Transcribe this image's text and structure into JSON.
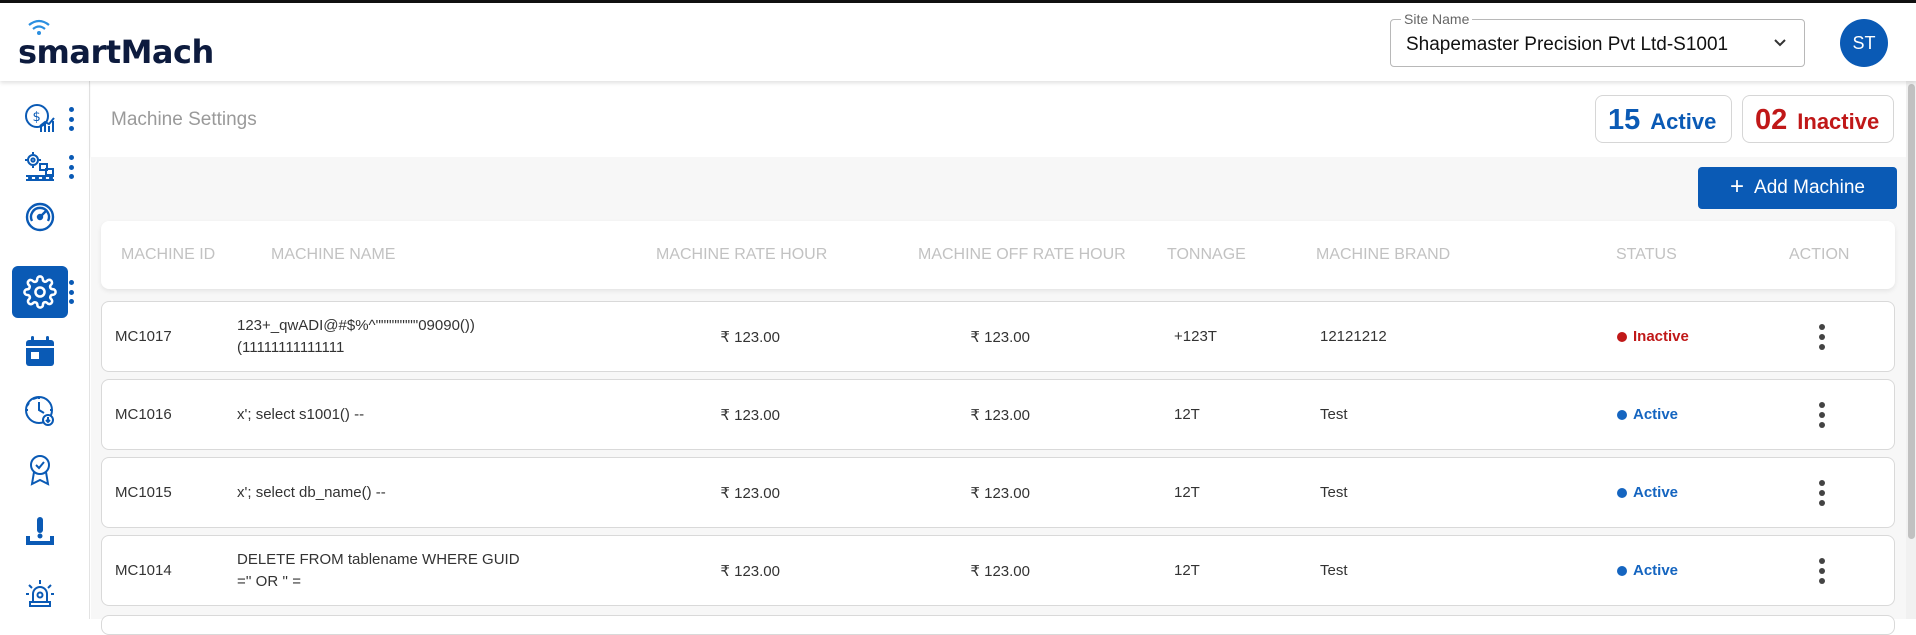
{
  "app": {
    "logo_text": "smartMach",
    "site_label": "Site Name",
    "site_value": "Shapemaster Precision Pvt Ltd-S1001",
    "avatar_initials": "ST"
  },
  "sidebar": {
    "items": [
      {
        "icon": "cost-analytics-icon",
        "has_menu": true
      },
      {
        "icon": "machine-conveyor-icon",
        "has_menu": true
      },
      {
        "icon": "gauge-icon",
        "has_menu": false
      },
      {
        "icon": "settings-gear-icon",
        "has_menu": true,
        "active": true
      },
      {
        "icon": "calendar-icon",
        "has_menu": false
      },
      {
        "icon": "clock-download-icon",
        "has_menu": false
      },
      {
        "icon": "award-badge-icon",
        "has_menu": false
      },
      {
        "icon": "tool-probe-icon",
        "has_menu": false
      },
      {
        "icon": "alarm-light-icon",
        "has_menu": false
      }
    ]
  },
  "page": {
    "title": "Machine Settings",
    "active_count": "15",
    "active_label": "Active",
    "inactive_count": "02",
    "inactive_label": "Inactive",
    "add_button": "Add Machine"
  },
  "table": {
    "headers": [
      "MACHINE ID",
      "MACHINE NAME",
      "MACHINE RATE HOUR",
      "MACHINE OFF RATE HOUR",
      "TONNAGE",
      "MACHINE BRAND",
      "STATUS",
      "ACTION"
    ],
    "rows": [
      {
        "id": "MC1017",
        "name": "123+_qwADI@#$%^\"\"\"\"\"\"\"\"09090())(11111111111111",
        "rate": "₹ 123.00",
        "off_rate": "₹ 123.00",
        "tonnage": "+123T",
        "brand": "12121212",
        "status": "Inactive"
      },
      {
        "id": "MC1016",
        "name": "x'; select s1001() --",
        "rate": "₹ 123.00",
        "off_rate": "₹ 123.00",
        "tonnage": "12T",
        "brand": "Test",
        "status": "Active"
      },
      {
        "id": "MC1015",
        "name": "x'; select db_name() --",
        "rate": "₹ 123.00",
        "off_rate": "₹ 123.00",
        "tonnage": "12T",
        "brand": "Test",
        "status": "Active"
      },
      {
        "id": "MC1014",
        "name": "DELETE FROM tablename WHERE GUID ='' OR '' =",
        "rate": "₹ 123.00",
        "off_rate": "₹ 123.00",
        "tonnage": "12T",
        "brand": "Test",
        "status": "Active"
      }
    ]
  },
  "colors": {
    "brand_blue": "#0a5ab5",
    "inactive_red": "#c01818",
    "active_blue": "#1565c0"
  }
}
